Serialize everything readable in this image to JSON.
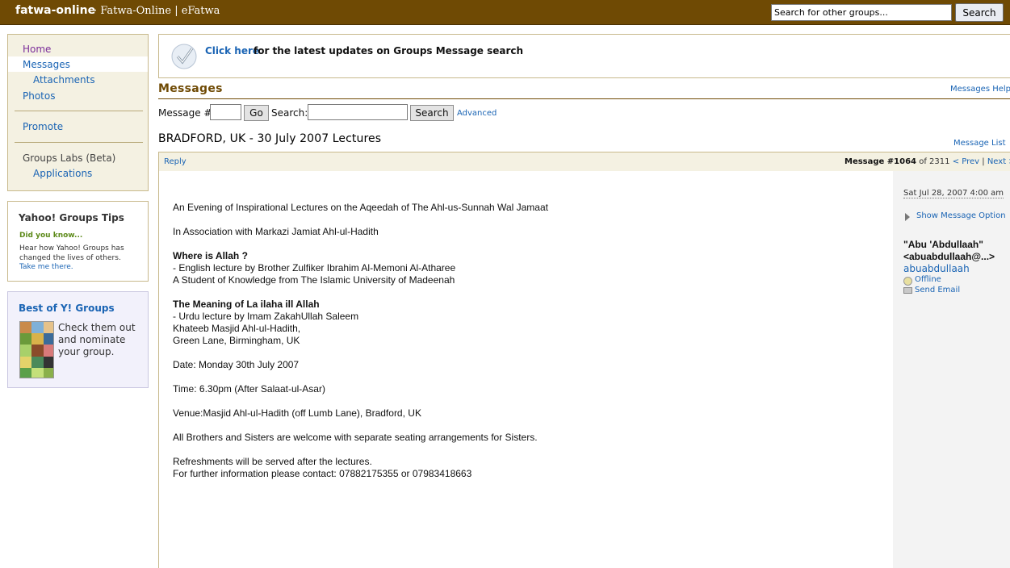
{
  "header": {
    "group_name": "fatwa-online",
    "group_subtitle": "· Fatwa-Online | eFatwa",
    "search_placeholder": "Search for other groups...",
    "search_button": "Search"
  },
  "nav": {
    "home": "Home",
    "messages": "Messages",
    "attachments": "Attachments",
    "photos": "Photos",
    "promote": "Promote",
    "labs": "Groups Labs (Beta)",
    "applications": "Applications"
  },
  "tips": {
    "title": "Yahoo! Groups Tips",
    "did_you_know": "Did you know...",
    "text": "Hear how Yahoo! Groups has changed the lives of others.",
    "link": "Take me there."
  },
  "bestof": {
    "title": "Best of Y! Groups",
    "text": "Check them out and nominate your group."
  },
  "notice": {
    "link": "Click here",
    "text": "for the latest updates on Groups Message search"
  },
  "messages": {
    "heading": "Messages",
    "help": "Messages Help",
    "msgnum_label": "Message #",
    "go": "Go",
    "search_label": "Search:",
    "search_button": "Search",
    "advanced": "Advanced",
    "subject": "BRADFORD, UK - 30 July 2007 Lectures",
    "message_list": "Message List",
    "reply": "Reply",
    "position_label": "Message #1064",
    "position_of": "of 2311",
    "prev": "< Prev",
    "sep": "|",
    "next": "Next >"
  },
  "body_lines": [
    "An Evening of Inspirational Lectures on the Aqeedah of The Ahl-us-Sunnah Wal Jamaat",
    "In Association with Markazi Jamiat Ahl-ul-Hadith",
    "Where is Allah ?",
    "- English lecture by Brother Zulfiker Ibrahim Al-Memoni Al-Atharee",
    "A Student of Knowledge from The Islamic University of Madeenah",
    "The Meaning of La ilaha ill Allah",
    "- Urdu lecture by Imam ZakahUllah Saleem",
    "Khateeb Masjid Ahl-ul-Hadith,",
    "Green Lane, Birmingham, UK",
    "Date: Monday 30th July 2007",
    "Time: 6.30pm (After Salaat-ul-Asar)",
    "Venue:Masjid Ahl-ul-Hadith (off Lumb Lane), Bradford, UK",
    "All Brothers and Sisters are welcome with separate seating arrangements for Sisters.",
    "Refreshments will be served after the lectures.",
    "For further information please contact:  07882175355 or  07983418663"
  ],
  "side": {
    "date": "Sat Jul 28, 2007 4:00 am",
    "show_options": "Show Message Option",
    "author_name": "\"Abu 'Abdullaah\" <abuabdullaah@...>",
    "author_id": "abuabdullaah",
    "status": "Offline",
    "send_email": "Send Email"
  }
}
